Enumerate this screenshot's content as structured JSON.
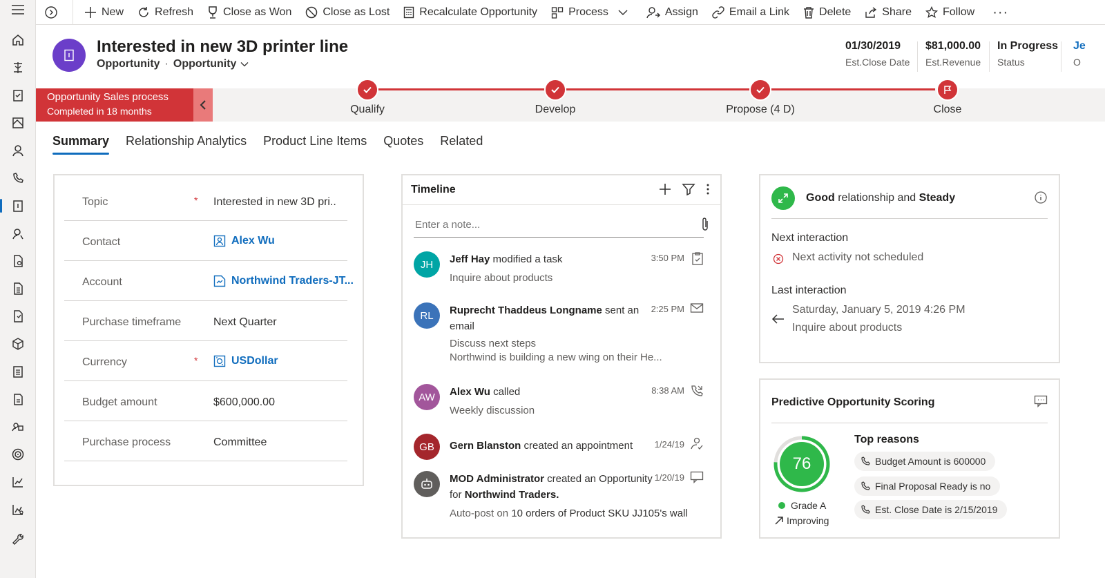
{
  "rail": {
    "icons": [
      "menu-icon",
      "home-icon",
      "pin-icon",
      "clipboard-icon",
      "dashboard-icon",
      "contact-icon",
      "phone-icon",
      "opportunity-icon",
      "lead-icon",
      "quote-icon",
      "order-icon",
      "invoice-icon",
      "product-icon",
      "document-icon",
      "sales-literature-icon",
      "competitor-icon",
      "goal-icon",
      "chart-icon",
      "forecast-icon",
      "wrench-icon"
    ]
  },
  "toolbar": {
    "new": "New",
    "refresh": "Refresh",
    "close_won": "Close as Won",
    "close_lost": "Close as Lost",
    "recalculate": "Recalculate Opportunity",
    "process": "Process",
    "assign": "Assign",
    "email_link": "Email a Link",
    "delete": "Delete",
    "share": "Share",
    "follow": "Follow",
    "more": "···"
  },
  "header": {
    "title": "Interested in new 3D printer line",
    "entity": "Opportunity",
    "form": "Opportunity",
    "fields": [
      {
        "value": "01/30/2019",
        "label": "Est.Close Date"
      },
      {
        "value": "$81,000.00",
        "label": "Est.Revenue"
      },
      {
        "value": "In Progress",
        "label": "Status"
      },
      {
        "value": "Je",
        "label": "O"
      }
    ]
  },
  "bpf": {
    "name": "Opportunity Sales process",
    "status": "Completed in 18 months",
    "stages": [
      {
        "label": "Qualify",
        "state": "complete"
      },
      {
        "label": "Develop",
        "state": "complete"
      },
      {
        "label": "Propose (4 D)",
        "state": "complete"
      },
      {
        "label": "Close",
        "state": "active"
      }
    ]
  },
  "tabs": [
    "Summary",
    "Relationship Analytics",
    "Product Line Items",
    "Quotes",
    "Related"
  ],
  "summary": {
    "fields": [
      {
        "label": "Topic",
        "required": true,
        "value": "Interested in new 3D pri..",
        "type": "text"
      },
      {
        "label": "Contact",
        "required": false,
        "value": "Alex Wu",
        "type": "link"
      },
      {
        "label": "Account",
        "required": false,
        "value": "Northwind Traders-JT...",
        "type": "link"
      },
      {
        "label": "Purchase timeframe",
        "required": false,
        "value": "Next Quarter",
        "type": "text"
      },
      {
        "label": "Currency",
        "required": true,
        "value": "USDollar",
        "type": "link"
      },
      {
        "label": "Budget amount",
        "required": false,
        "value": "$600,000.00",
        "type": "text"
      },
      {
        "label": "Purchase process",
        "required": false,
        "value": "Committee",
        "type": "text"
      }
    ],
    "required_mark": "*"
  },
  "timeline": {
    "title": "Timeline",
    "note_placeholder": "Enter a note...",
    "items": [
      {
        "initials": "JH",
        "color": "#00a5a5",
        "actor": "Jeff Hay",
        "action": " modified a task",
        "sub": "Inquire about products",
        "time": "3:50 PM",
        "icon": "task-icon"
      },
      {
        "initials": "RL",
        "color": "#3b73b9",
        "actor": "Ruprecht Thaddeus Longname",
        "action": " sent an email",
        "sub": "Discuss next steps",
        "desc": "Northwind is building a new wing on their He...",
        "time": "2:25 PM",
        "icon": "mail-icon"
      },
      {
        "initials": "AW",
        "color": "#a2569b",
        "actor": "Alex Wu",
        "action": " called",
        "sub": "Weekly discussion",
        "time": "8:38 AM",
        "icon": "phone-call-icon"
      },
      {
        "initials": "GB",
        "color": "#a4262c",
        "actor": "Gern Blanston",
        "action": " created an appointment",
        "time": "1/24/19",
        "icon": "appointment-icon"
      },
      {
        "initials": "",
        "color": "#605e5c",
        "actor": "MOD Administrator",
        "action": " created an Opportunity for ",
        "target": "Northwind Traders.",
        "sub_prefix": "Auto-post on ",
        "sub_bold": "10 orders of Product SKU JJ105's wall",
        "time": "1/20/19",
        "icon": "post-icon"
      }
    ]
  },
  "relationship": {
    "health": "Good",
    "joiner": " relationship and ",
    "trend": "Steady",
    "next_label": "Next interaction",
    "next_value": "Next activity not scheduled",
    "last_label": "Last interaction",
    "last_date": "Saturday, January 5, 2019 4:26 PM",
    "last_subject": "Inquire about products"
  },
  "scoring": {
    "title": "Predictive Opportunity Scoring",
    "score": "76",
    "score_fraction": 0.76,
    "grade": "Grade A",
    "trend": "Improving",
    "reasons_title": "Top reasons",
    "reasons": [
      "Budget Amount is 600000",
      "Final Proposal Ready is no",
      "Est. Close Date is 2/15/2019"
    ]
  },
  "colors": {
    "accent": "#0f6cbd",
    "bpf_red": "#d13438",
    "score_green": "#2fb84a",
    "entity_purple": "#6b3ec9"
  }
}
